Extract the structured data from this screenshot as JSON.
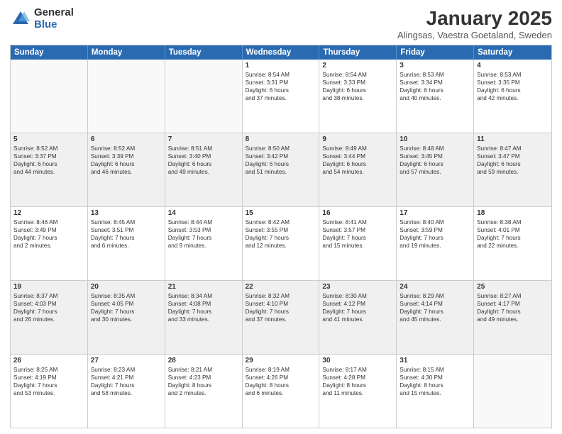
{
  "logo": {
    "general": "General",
    "blue": "Blue"
  },
  "header": {
    "title": "January 2025",
    "subtitle": "Alingsas, Vaestra Goetaland, Sweden"
  },
  "weekdays": [
    "Sunday",
    "Monday",
    "Tuesday",
    "Wednesday",
    "Thursday",
    "Friday",
    "Saturday"
  ],
  "weeks": [
    [
      {
        "day": "",
        "text": "",
        "empty": true
      },
      {
        "day": "",
        "text": "",
        "empty": true
      },
      {
        "day": "",
        "text": "",
        "empty": true
      },
      {
        "day": "1",
        "text": "Sunrise: 8:54 AM\nSunset: 3:31 PM\nDaylight: 6 hours\nand 37 minutes.",
        "empty": false
      },
      {
        "day": "2",
        "text": "Sunrise: 8:54 AM\nSunset: 3:33 PM\nDaylight: 6 hours\nand 38 minutes.",
        "empty": false
      },
      {
        "day": "3",
        "text": "Sunrise: 8:53 AM\nSunset: 3:34 PM\nDaylight: 6 hours\nand 40 minutes.",
        "empty": false
      },
      {
        "day": "4",
        "text": "Sunrise: 8:53 AM\nSunset: 3:35 PM\nDaylight: 6 hours\nand 42 minutes.",
        "empty": false
      }
    ],
    [
      {
        "day": "5",
        "text": "Sunrise: 8:52 AM\nSunset: 3:37 PM\nDaylight: 6 hours\nand 44 minutes.",
        "empty": false,
        "shaded": true
      },
      {
        "day": "6",
        "text": "Sunrise: 8:52 AM\nSunset: 3:39 PM\nDaylight: 6 hours\nand 46 minutes.",
        "empty": false,
        "shaded": true
      },
      {
        "day": "7",
        "text": "Sunrise: 8:51 AM\nSunset: 3:40 PM\nDaylight: 6 hours\nand 49 minutes.",
        "empty": false,
        "shaded": true
      },
      {
        "day": "8",
        "text": "Sunrise: 8:50 AM\nSunset: 3:42 PM\nDaylight: 6 hours\nand 51 minutes.",
        "empty": false,
        "shaded": true
      },
      {
        "day": "9",
        "text": "Sunrise: 8:49 AM\nSunset: 3:44 PM\nDaylight: 6 hours\nand 54 minutes.",
        "empty": false,
        "shaded": true
      },
      {
        "day": "10",
        "text": "Sunrise: 8:48 AM\nSunset: 3:45 PM\nDaylight: 6 hours\nand 57 minutes.",
        "empty": false,
        "shaded": true
      },
      {
        "day": "11",
        "text": "Sunrise: 8:47 AM\nSunset: 3:47 PM\nDaylight: 6 hours\nand 59 minutes.",
        "empty": false,
        "shaded": true
      }
    ],
    [
      {
        "day": "12",
        "text": "Sunrise: 8:46 AM\nSunset: 3:49 PM\nDaylight: 7 hours\nand 2 minutes.",
        "empty": false
      },
      {
        "day": "13",
        "text": "Sunrise: 8:45 AM\nSunset: 3:51 PM\nDaylight: 7 hours\nand 6 minutes.",
        "empty": false
      },
      {
        "day": "14",
        "text": "Sunrise: 8:44 AM\nSunset: 3:53 PM\nDaylight: 7 hours\nand 9 minutes.",
        "empty": false
      },
      {
        "day": "15",
        "text": "Sunrise: 8:42 AM\nSunset: 3:55 PM\nDaylight: 7 hours\nand 12 minutes.",
        "empty": false
      },
      {
        "day": "16",
        "text": "Sunrise: 8:41 AM\nSunset: 3:57 PM\nDaylight: 7 hours\nand 15 minutes.",
        "empty": false
      },
      {
        "day": "17",
        "text": "Sunrise: 8:40 AM\nSunset: 3:59 PM\nDaylight: 7 hours\nand 19 minutes.",
        "empty": false
      },
      {
        "day": "18",
        "text": "Sunrise: 8:38 AM\nSunset: 4:01 PM\nDaylight: 7 hours\nand 22 minutes.",
        "empty": false
      }
    ],
    [
      {
        "day": "19",
        "text": "Sunrise: 8:37 AM\nSunset: 4:03 PM\nDaylight: 7 hours\nand 26 minutes.",
        "empty": false,
        "shaded": true
      },
      {
        "day": "20",
        "text": "Sunrise: 8:35 AM\nSunset: 4:05 PM\nDaylight: 7 hours\nand 30 minutes.",
        "empty": false,
        "shaded": true
      },
      {
        "day": "21",
        "text": "Sunrise: 8:34 AM\nSunset: 4:08 PM\nDaylight: 7 hours\nand 33 minutes.",
        "empty": false,
        "shaded": true
      },
      {
        "day": "22",
        "text": "Sunrise: 8:32 AM\nSunset: 4:10 PM\nDaylight: 7 hours\nand 37 minutes.",
        "empty": false,
        "shaded": true
      },
      {
        "day": "23",
        "text": "Sunrise: 8:30 AM\nSunset: 4:12 PM\nDaylight: 7 hours\nand 41 minutes.",
        "empty": false,
        "shaded": true
      },
      {
        "day": "24",
        "text": "Sunrise: 8:29 AM\nSunset: 4:14 PM\nDaylight: 7 hours\nand 45 minutes.",
        "empty": false,
        "shaded": true
      },
      {
        "day": "25",
        "text": "Sunrise: 8:27 AM\nSunset: 4:17 PM\nDaylight: 7 hours\nand 49 minutes.",
        "empty": false,
        "shaded": true
      }
    ],
    [
      {
        "day": "26",
        "text": "Sunrise: 8:25 AM\nSunset: 4:19 PM\nDaylight: 7 hours\nand 53 minutes.",
        "empty": false
      },
      {
        "day": "27",
        "text": "Sunrise: 8:23 AM\nSunset: 4:21 PM\nDaylight: 7 hours\nand 58 minutes.",
        "empty": false
      },
      {
        "day": "28",
        "text": "Sunrise: 8:21 AM\nSunset: 4:23 PM\nDaylight: 8 hours\nand 2 minutes.",
        "empty": false
      },
      {
        "day": "29",
        "text": "Sunrise: 8:19 AM\nSunset: 4:26 PM\nDaylight: 8 hours\nand 6 minutes.",
        "empty": false
      },
      {
        "day": "30",
        "text": "Sunrise: 8:17 AM\nSunset: 4:28 PM\nDaylight: 8 hours\nand 11 minutes.",
        "empty": false
      },
      {
        "day": "31",
        "text": "Sunrise: 8:15 AM\nSunset: 4:30 PM\nDaylight: 8 hours\nand 15 minutes.",
        "empty": false
      },
      {
        "day": "",
        "text": "",
        "empty": true
      }
    ]
  ]
}
